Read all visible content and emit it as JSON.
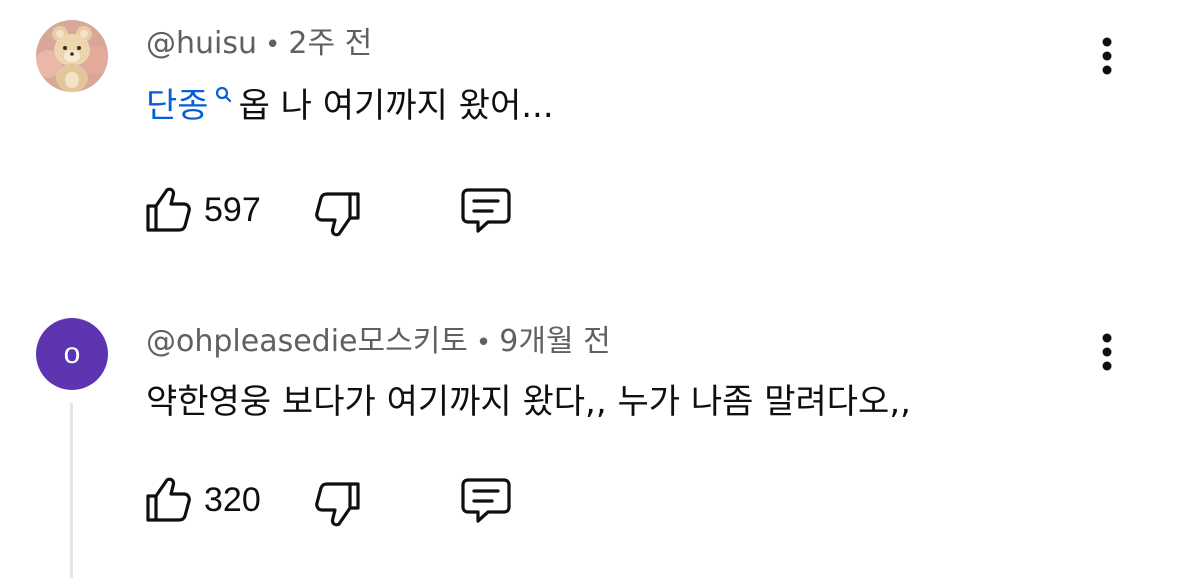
{
  "comments": [
    {
      "author": "@huisu",
      "time": "2주 전",
      "link_text": "단종",
      "text": "옵 나 여기까지 왔어...",
      "likes": "597",
      "avatar_icon": "teddy-bear-avatar"
    },
    {
      "author": "@ohpleasedie모스키토",
      "time": "9개월 전",
      "avatar_letter": "o",
      "text": "약한영웅 보다가 여기까지 왔다,, 누가 나좀 말려다오,,",
      "likes": "320"
    }
  ],
  "separator": "•",
  "colors": {
    "link": "#065fd4",
    "avatar_purple": "#5e35b1",
    "meta": "#606060"
  }
}
